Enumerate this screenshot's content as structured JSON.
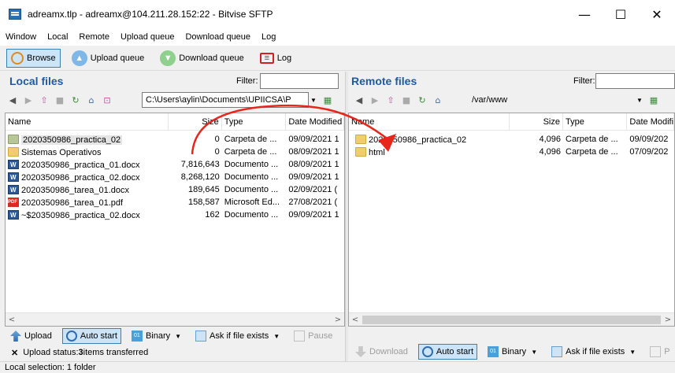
{
  "window": {
    "title": "adreamx.tlp - adreamx@104.211.28.152:22 - Bitvise SFTP",
    "minimize": "—",
    "maximize": "☐",
    "close": "✕"
  },
  "menu": [
    "Window",
    "Local",
    "Remote",
    "Upload queue",
    "Download queue",
    "Log"
  ],
  "toolbar": {
    "browse": "Browse",
    "upload_queue": "Upload queue",
    "download_queue": "Download queue",
    "log": "Log"
  },
  "local": {
    "title": "Local files",
    "filter_label": "Filter:",
    "path": "C:\\Users\\aylin\\Documents\\UPIICSA\\P",
    "columns": [
      "Name",
      "Size",
      "Type",
      "Date Modified"
    ],
    "rows": [
      {
        "name": "2020350986_practica_02",
        "size": "0",
        "type": "Carpeta de ...",
        "date": "09/09/2021 1",
        "icon": "folder-selected"
      },
      {
        "name": "Sistemas Operativos",
        "size": "0",
        "type": "Carpeta de ...",
        "date": "08/09/2021 1",
        "icon": "folder"
      },
      {
        "name": "2020350986_practica_01.docx",
        "size": "7,816,643",
        "type": "Documento ...",
        "date": "08/09/2021 1",
        "icon": "word"
      },
      {
        "name": "2020350986_practica_02.docx",
        "size": "8,268,120",
        "type": "Documento ...",
        "date": "09/09/2021 1",
        "icon": "word"
      },
      {
        "name": "2020350986_tarea_01.docx",
        "size": "189,645",
        "type": "Documento ...",
        "date": "02/09/2021 (",
        "icon": "word"
      },
      {
        "name": "2020350986_tarea_01.pdf",
        "size": "158,587",
        "type": "Microsoft Ed...",
        "date": "27/08/2021 (",
        "icon": "pdf"
      },
      {
        "name": "~$20350986_practica_02.docx",
        "size": "162",
        "type": "Documento ...",
        "date": "09/09/2021 1",
        "icon": "word"
      }
    ],
    "bottom": {
      "upload": "Upload",
      "auto_start": "Auto start",
      "binary": "Binary",
      "ask": "Ask if file exists",
      "pause": "Pause"
    },
    "status": "Upload status: ",
    "status_count": "3",
    "status_suffix": " items transferred"
  },
  "remote": {
    "title": "Remote files",
    "filter_label": "Filter:",
    "path": "/var/www",
    "columns": [
      "Name",
      "Size",
      "Type",
      "Date Modifi"
    ],
    "rows": [
      {
        "name": "2020350986_practica_02",
        "size": "4,096",
        "type": "Carpeta de ...",
        "date": "09/09/202",
        "icon": "folder"
      },
      {
        "name": "html",
        "size": "4,096",
        "type": "Carpeta de ...",
        "date": "07/09/202",
        "icon": "folder"
      }
    ],
    "bottom": {
      "download": "Download",
      "auto_start": "Auto start",
      "binary": "Binary",
      "ask": "Ask if file exists",
      "pause": "P"
    }
  },
  "statusbar": "Local selection: 1 folder",
  "colors": {
    "accent": "#1e5aa8",
    "arrow": "#e8261c",
    "selection": "#cce4f7"
  }
}
